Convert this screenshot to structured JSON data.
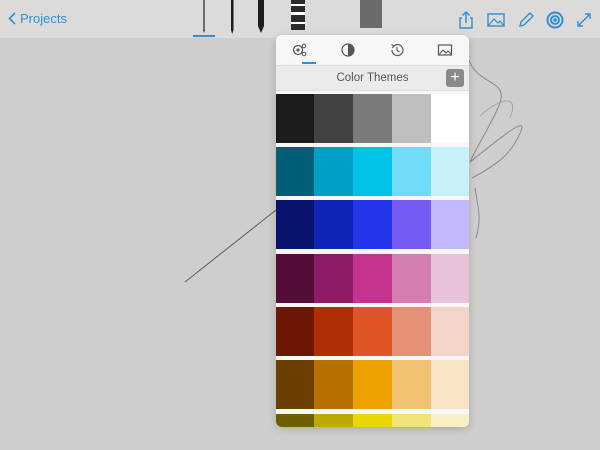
{
  "toolbar": {
    "back_label": "Projects",
    "brushes": [
      "pencil",
      "ink-pen",
      "marker",
      "brush",
      "eraser"
    ],
    "right_icons": [
      "share-icon",
      "image-icon",
      "pencil-icon",
      "color-wheel-icon",
      "expand-icon"
    ]
  },
  "popover": {
    "tabs": [
      "color-themes-icon",
      "color-mixer-icon",
      "history-icon",
      "image-capture-icon"
    ],
    "active_tab": "color-themes-icon",
    "title": "Color Themes",
    "add_label": "+"
  },
  "themes": [
    [
      "#1c1c1c",
      "#434343",
      "#7b7b7b",
      "#bebebe",
      "#ffffff"
    ],
    [
      "#005f75",
      "#009fc7",
      "#00c2e8",
      "#6fdcf7",
      "#c9f0f8"
    ],
    [
      "#07136c",
      "#0e25b7",
      "#2436e9",
      "#7659f2",
      "#c1b9fb"
    ],
    [
      "#530d39",
      "#8f1b66",
      "#c4338e",
      "#d47db1",
      "#e7c3da"
    ],
    [
      "#6f1706",
      "#b02d05",
      "#e05425",
      "#e49178",
      "#f2d4c8"
    ],
    [
      "#6a3f00",
      "#b57000",
      "#eda100",
      "#f2c273",
      "#f8e3c4"
    ],
    [
      "#6b5f00",
      "#bba900",
      "#e9d600",
      "#f0e37a",
      "#f6f0c2"
    ]
  ]
}
